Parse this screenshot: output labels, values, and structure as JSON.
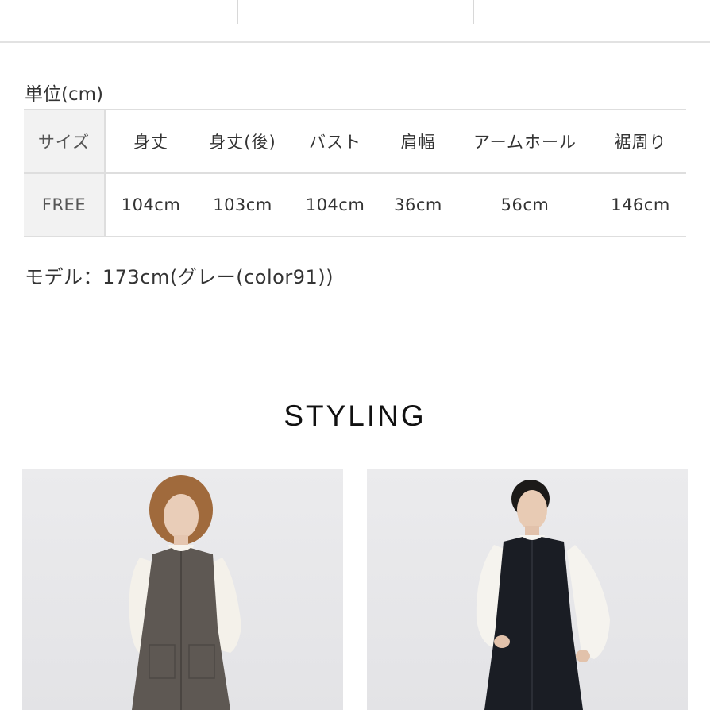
{
  "size_section": {
    "unit_label": "単位(cm)",
    "table": {
      "headers": [
        "サイズ",
        "身丈",
        "身丈(後)",
        "バスト",
        "肩幅",
        "アームホール",
        "裾周り"
      ],
      "rows": [
        [
          "FREE",
          "104cm",
          "103cm",
          "104cm",
          "36cm",
          "56cm",
          "146cm"
        ]
      ]
    },
    "model_note": "モデル：173cm(グレー(color91))"
  },
  "styling": {
    "heading": "STYLING",
    "photos": [
      {
        "dress_color": "#5e5853",
        "hair_color": "#a06a3c"
      },
      {
        "dress_color": "#1a1d24",
        "hair_color": "#1c1a18"
      }
    ]
  }
}
